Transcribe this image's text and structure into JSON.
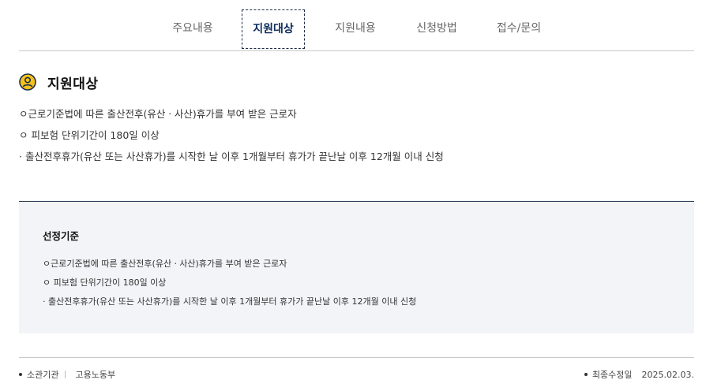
{
  "tabs": [
    {
      "label": "주요내용",
      "active": false
    },
    {
      "label": "지원대상",
      "active": true
    },
    {
      "label": "지원내용",
      "active": false
    },
    {
      "label": "신청방법",
      "active": false
    },
    {
      "label": "접수/문의",
      "active": false
    }
  ],
  "section": {
    "title": "지원대상",
    "icon": "person-circle-icon",
    "lines": [
      "ㅇ근로기준법에 따른 출산전후(유산ㆍ사산)휴가를 부여 받은 근로자",
      "ㅇ 피보험 단위기간이 180일 이상",
      "· 출산전후휴가(유산 또는 사산휴가)를 시작한 날 이후 1개월부터 휴가가 끝난날 이후 12개월 이내 신청"
    ]
  },
  "criteria": {
    "title": "선정기준",
    "lines": [
      "ㅇ근로기준법에 따른 출산전후(유산ㆍ사산)휴가를 부여 받은 근로자",
      "ㅇ 피보험 단위기간이 180일 이상",
      "· 출산전후휴가(유산 또는 사산휴가)를 시작한 날 이후 1개월부터 휴가가 끝난날 이후 12개월 이내 신청"
    ]
  },
  "footer": {
    "agency_label": "소관기관",
    "agency_value": "고용노동부",
    "updated_label": "최종수정일",
    "updated_value": "2025.02.03."
  },
  "colors": {
    "active_tab": "#0b2a5a",
    "icon_fill": "#f5c21b",
    "box_bg": "#f3f4f7"
  }
}
